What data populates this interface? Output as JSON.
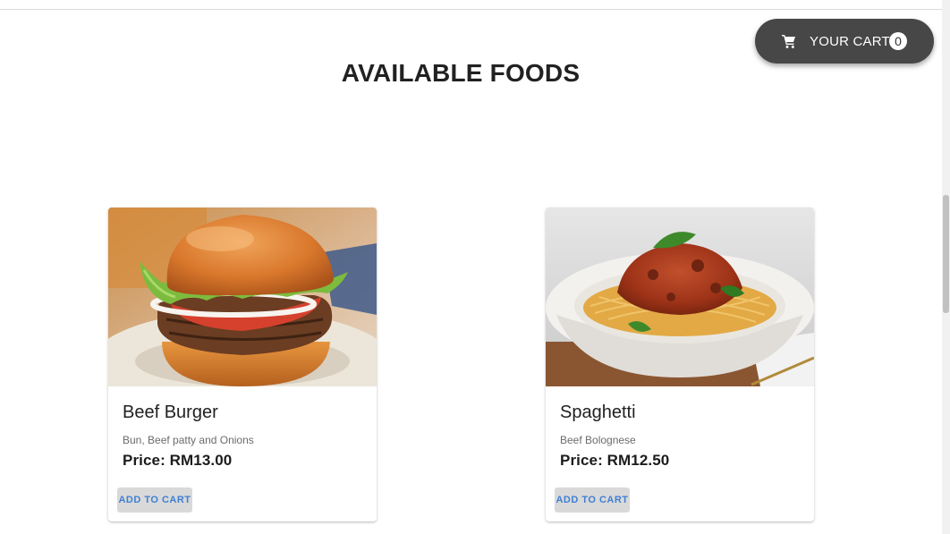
{
  "cart": {
    "label": "YOUR CART",
    "count": "0",
    "icon": "cart-icon"
  },
  "page": {
    "title": "AVAILABLE FOODS"
  },
  "foods": [
    {
      "name": "Beef Burger",
      "description": "Bun, Beef patty and Onions",
      "price": "Price: RM13.00",
      "button": "ADD TO CART",
      "image": "burger-photo"
    },
    {
      "name": "Spaghetti",
      "description": "Beef Bolognese",
      "price": "Price: RM12.50",
      "button": "ADD TO CART",
      "image": "spaghetti-photo"
    }
  ],
  "colors": {
    "cart_button_bg": "#474747",
    "add_button_bg": "#d9d9d9",
    "add_button_text": "#3f7fd3"
  }
}
